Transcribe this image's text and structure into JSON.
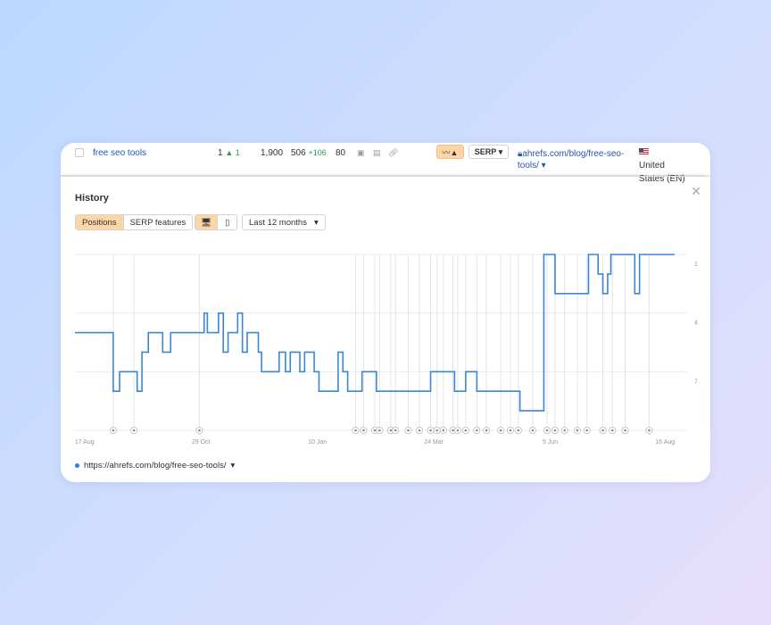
{
  "row": {
    "keyword": "free seo tools",
    "position": "1",
    "position_change": "1",
    "volume": "1,900",
    "kd": "506",
    "kd_change": "+106",
    "traffic": "80",
    "serp_button": "SERP",
    "url": "ahrefs.com/blog/free-seo-tools/",
    "country": "United States (EN)",
    "icons": [
      "serp-feature-icon",
      "news-icon",
      "link-icon",
      "lock-icon",
      "trend-icon",
      "flag-us-icon"
    ]
  },
  "history": {
    "title": "History",
    "close_icon": "close-icon",
    "tabs": [
      {
        "label": "Positions",
        "active": true
      },
      {
        "label": "SERP features",
        "active": false
      }
    ],
    "devices": [
      {
        "name": "desktop-icon",
        "active": true
      },
      {
        "name": "mobile-icon",
        "active": false
      }
    ],
    "range": "Last 12 months",
    "legend": "https://ahrefs.com/blog/free-seo-tools/",
    "line_color": "#3b86d6",
    "accent": "#fdd6a5"
  },
  "chart_data": {
    "type": "line",
    "step": true,
    "y_reversed": true,
    "ylim": [
      1,
      10
    ],
    "y_ticks": [
      "1",
      "4",
      "7"
    ],
    "y_tick_values": [
      1,
      4,
      7
    ],
    "x_ticks": [
      "17 Aug",
      "29 Oct",
      "10 Jan",
      "24 Mar",
      "5 Jun",
      "16 Aug"
    ],
    "x_tick_dates": [
      "2022-08-17",
      "2022-10-29",
      "2023-01-10",
      "2023-03-24",
      "2023-06-05",
      "2023-08-16"
    ],
    "xlim": [
      "2022-08-11",
      "2023-08-22"
    ],
    "grid": true,
    "series": [
      {
        "name": "https://ahrefs.com/blog/free-seo-tools/",
        "points": [
          [
            "2022-08-11",
            5
          ],
          [
            "2022-09-04",
            8
          ],
          [
            "2022-09-08",
            7
          ],
          [
            "2022-09-19",
            8
          ],
          [
            "2022-09-22",
            6
          ],
          [
            "2022-09-26",
            5
          ],
          [
            "2022-10-05",
            6
          ],
          [
            "2022-10-10",
            5
          ],
          [
            "2022-10-31",
            4
          ],
          [
            "2022-11-02",
            5
          ],
          [
            "2022-11-09",
            4
          ],
          [
            "2022-11-12",
            6
          ],
          [
            "2022-11-15",
            5
          ],
          [
            "2022-11-21",
            4
          ],
          [
            "2022-11-24",
            6
          ],
          [
            "2022-11-27",
            5
          ],
          [
            "2022-12-04",
            6
          ],
          [
            "2022-12-06",
            7
          ],
          [
            "2022-12-17",
            6
          ],
          [
            "2022-12-21",
            7
          ],
          [
            "2022-12-24",
            6
          ],
          [
            "2022-12-30",
            7
          ],
          [
            "2023-01-02",
            6
          ],
          [
            "2023-01-08",
            7
          ],
          [
            "2023-01-11",
            8
          ],
          [
            "2023-01-23",
            6
          ],
          [
            "2023-01-26",
            7
          ],
          [
            "2023-01-29",
            8
          ],
          [
            "2023-02-07",
            7
          ],
          [
            "2023-02-16",
            8
          ],
          [
            "2023-03-22",
            7
          ],
          [
            "2023-04-06",
            8
          ],
          [
            "2023-04-13",
            7
          ],
          [
            "2023-04-20",
            8
          ],
          [
            "2023-05-17",
            9
          ],
          [
            "2023-06-01",
            1
          ],
          [
            "2023-06-08",
            3
          ],
          [
            "2023-06-29",
            1
          ],
          [
            "2023-07-05",
            2
          ],
          [
            "2023-07-08",
            3
          ],
          [
            "2023-07-11",
            2
          ],
          [
            "2023-07-13",
            1
          ],
          [
            "2023-07-28",
            3
          ],
          [
            "2023-07-31",
            1
          ],
          [
            "2023-08-22",
            1
          ]
        ]
      }
    ],
    "annotations": [
      "2022-09-04",
      "2022-09-17",
      "2022-10-28",
      "2023-02-03",
      "2023-02-08",
      "2023-02-15",
      "2023-02-18",
      "2023-02-25",
      "2023-02-28",
      "2023-03-08",
      "2023-03-15",
      "2023-03-22",
      "2023-03-26",
      "2023-03-30",
      "2023-04-05",
      "2023-04-08",
      "2023-04-13",
      "2023-04-20",
      "2023-04-26",
      "2023-05-05",
      "2023-05-11",
      "2023-05-16",
      "2023-05-25",
      "2023-06-03",
      "2023-06-08",
      "2023-06-14",
      "2023-06-22",
      "2023-06-28",
      "2023-07-08",
      "2023-07-14",
      "2023-07-22",
      "2023-08-06"
    ]
  }
}
